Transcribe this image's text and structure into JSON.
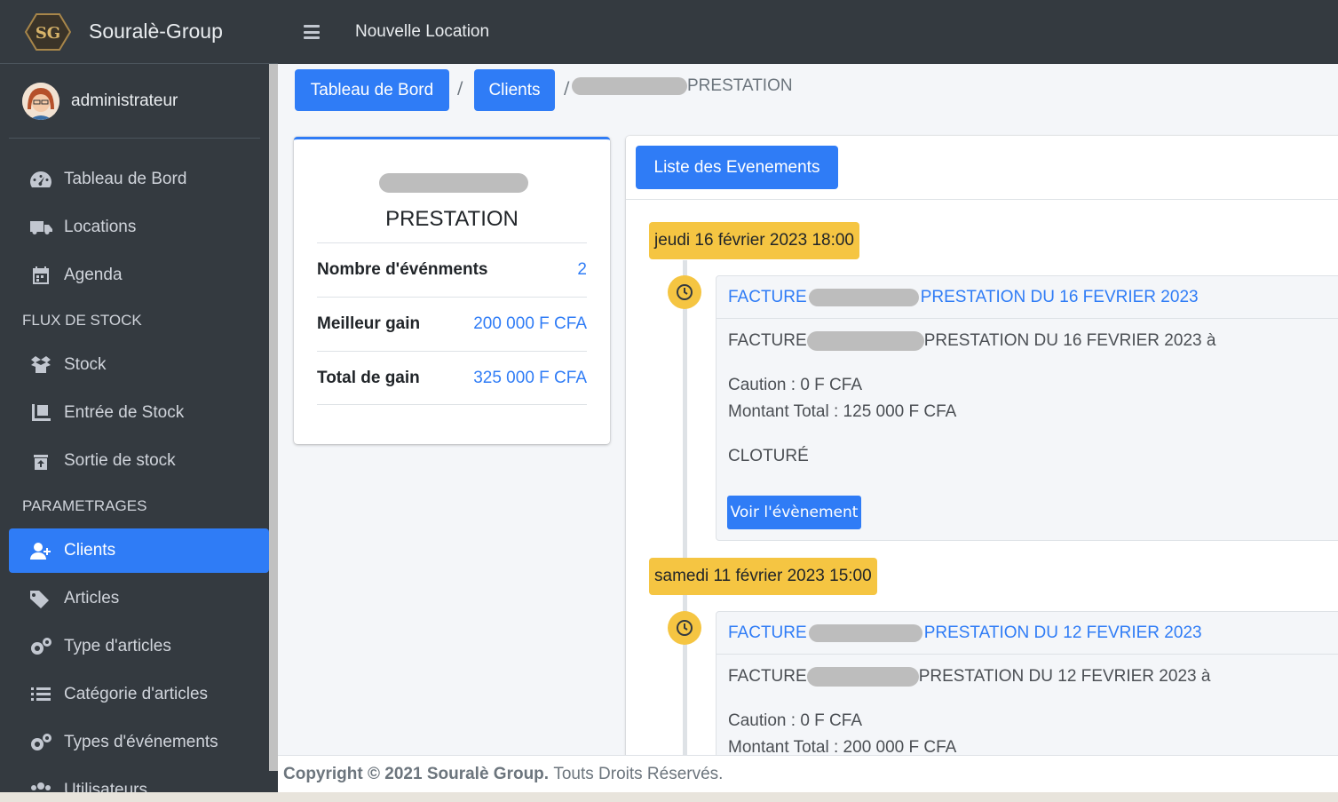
{
  "brand": {
    "name": "Souralè-Group",
    "logo_text": "SG"
  },
  "user": {
    "name": "administrateur"
  },
  "sidebar": {
    "items": [
      {
        "label": "Tableau de Bord",
        "icon": "tachometer-icon"
      },
      {
        "label": "Locations",
        "icon": "truck-icon"
      },
      {
        "label": "Agenda",
        "icon": "calendar-icon"
      },
      {
        "label": "Stock",
        "icon": "box-open-icon"
      },
      {
        "label": "Entrée de Stock",
        "icon": "dolly-icon"
      },
      {
        "label": "Sortie de stock",
        "icon": "trash-box-icon"
      },
      {
        "label": "Clients",
        "icon": "user-plus-icon",
        "active": true
      },
      {
        "label": "Articles",
        "icon": "tags-icon"
      },
      {
        "label": "Type d'articles",
        "icon": "cogs-icon"
      },
      {
        "label": "Catégorie d'articles",
        "icon": "list-icon"
      },
      {
        "label": "Types d'événements",
        "icon": "cogs-icon"
      },
      {
        "label": "Utilisateurs",
        "icon": "users-icon"
      }
    ],
    "headers": [
      "FLUX DE STOCK",
      "PARAMETRAGES"
    ]
  },
  "topbar": {
    "link": "Nouvelle Location"
  },
  "breadcrumb": {
    "home": "Tableau de Bord",
    "clients": "Clients",
    "sep": "/",
    "current_suffix": "PRESTATION"
  },
  "profile": {
    "title": "PRESTATION",
    "rows": [
      {
        "label": "Nombre d'événments",
        "value": "2"
      },
      {
        "label": "Meilleur gain",
        "value": "200 000 F CFA"
      },
      {
        "label": "Total de gain",
        "value": "325 000 F CFA"
      }
    ]
  },
  "timeline": {
    "button": "Liste des Evenements",
    "events": [
      {
        "date": "jeudi 16 février 2023 18:00",
        "title_prefix": "FACTURE",
        "title_suffix": "PRESTATION DU 16 FEVRIER 2023",
        "desc_prefix": "FACTURE",
        "desc_suffix": "PRESTATION DU 16 FEVRIER 2023 à",
        "caution": "Caution : 0 F CFA",
        "total": "Montant Total : 125 000 F CFA",
        "status": "CLOTURÉ",
        "button": "Voir l'évènement"
      },
      {
        "date": "samedi 11 février 2023 15:00",
        "title_prefix": "FACTURE",
        "title_suffix": "PRESTATION DU 12 FEVRIER 2023",
        "desc_prefix": "FACTURE",
        "desc_suffix": "PRESTATION DU 12 FEVRIER 2023 à",
        "caution": "Caution : 0 F CFA",
        "total": "Montant Total : 200 000 F CFA"
      }
    ]
  },
  "footer": {
    "copyright": "Copyright © 2021 Souralè Group.",
    "rights": "Touts Droits Réservés."
  },
  "colors": {
    "primary": "#2f7cf6",
    "sidebar": "#343a40",
    "warning": "#f5c542"
  }
}
